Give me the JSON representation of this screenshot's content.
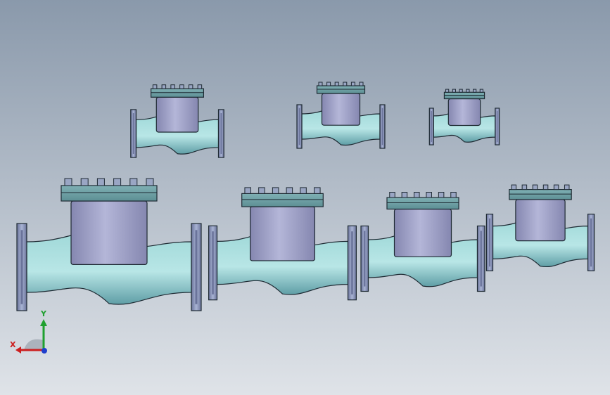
{
  "viewport": {
    "background_top": "#8a99ab",
    "background_bottom": "#dfe3e8"
  },
  "colors": {
    "pipe": "#9fd8d8",
    "pipe_shade": "#5f9ea6",
    "flange": "#a9b4d4",
    "flange_dark": "#6a739a",
    "bonnet": "#b4b6d8",
    "bonnet_dark": "#8587b0",
    "outline": "#1e2a33",
    "bolt": "#9aa6c4"
  },
  "scene": {
    "model_type": "swing check valve assembly",
    "valve_count": 7
  },
  "triad": {
    "x_label": "X",
    "y_label": "Y",
    "x_color": "#cc1f1f",
    "y_color": "#1fa02f",
    "z_color": "#1f3fcc"
  }
}
